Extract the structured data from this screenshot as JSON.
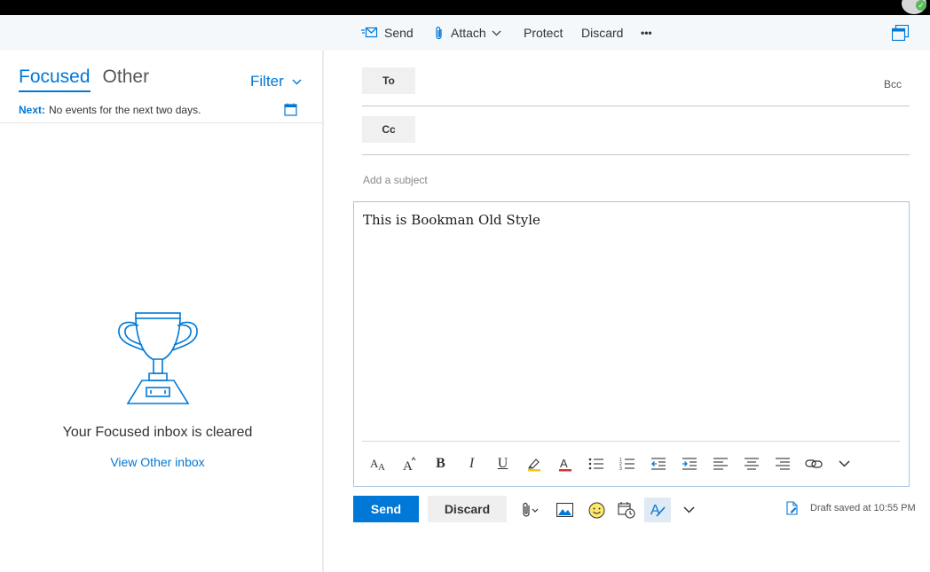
{
  "toolbar": {
    "send_label": "Send",
    "attach_label": "Attach",
    "protect_label": "Protect",
    "discard_label": "Discard",
    "more_label": "•••"
  },
  "inbox": {
    "tab_focused": "Focused",
    "tab_other": "Other",
    "filter_label": "Filter",
    "next_label": "Next:",
    "next_text": "No events for the next two days.",
    "empty_message": "Your Focused inbox is cleared",
    "view_other_link": "View Other inbox"
  },
  "compose": {
    "to_label": "To",
    "cc_label": "Cc",
    "bcc_label": "Bcc",
    "to_value": "",
    "cc_value": "",
    "subject_value": "",
    "subject_placeholder": "Add a subject",
    "body_text": "This is Bookman Old Style",
    "send_button": "Send",
    "discard_button": "Discard",
    "draft_status": "Draft saved at 10:55 PM"
  },
  "formatting": {
    "bold_glyph": "B",
    "italic_glyph": "I",
    "underline_glyph": "U"
  },
  "colors": {
    "accent": "#0078d7",
    "command_bar_bg": "#f4f8fb",
    "highlight_yellow": "#f2c811",
    "font_color_red": "#d13438"
  }
}
